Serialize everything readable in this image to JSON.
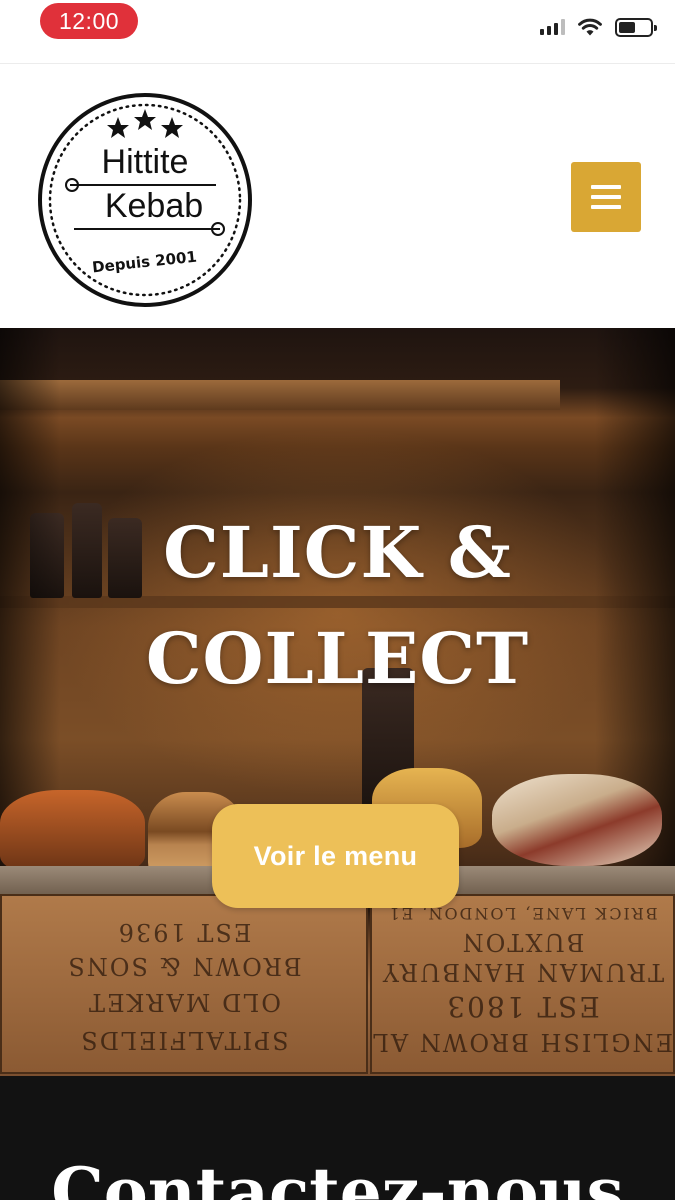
{
  "status_bar": {
    "time": "12:00"
  },
  "header": {
    "logo": {
      "line1": "Hittite",
      "line2": "Kebab",
      "tagline": "Depuis 2001"
    },
    "menu_icon": "hamburger-menu-icon"
  },
  "hero": {
    "title_line1": "CLICK &",
    "title_line2": "COLLECT",
    "button_label": "Voir le menu",
    "crate_left_lines": [
      "EST 1936",
      "BROWN & SONS",
      "OLD MARKET",
      "SPITALFIELDS"
    ],
    "crate_right_lines": [
      "BRICK LANE, LONDON, E1",
      "BUXTON",
      "TRUMAN HANBURY",
      "EST 1803",
      "ENGLISH BROWN ALE"
    ]
  },
  "contact": {
    "title": "Contactez-nous"
  },
  "colors": {
    "status_time_pill": "#e0313a",
    "menu_button": "#d9a734",
    "hero_button": "#edc058",
    "contact_background": "#121212"
  }
}
